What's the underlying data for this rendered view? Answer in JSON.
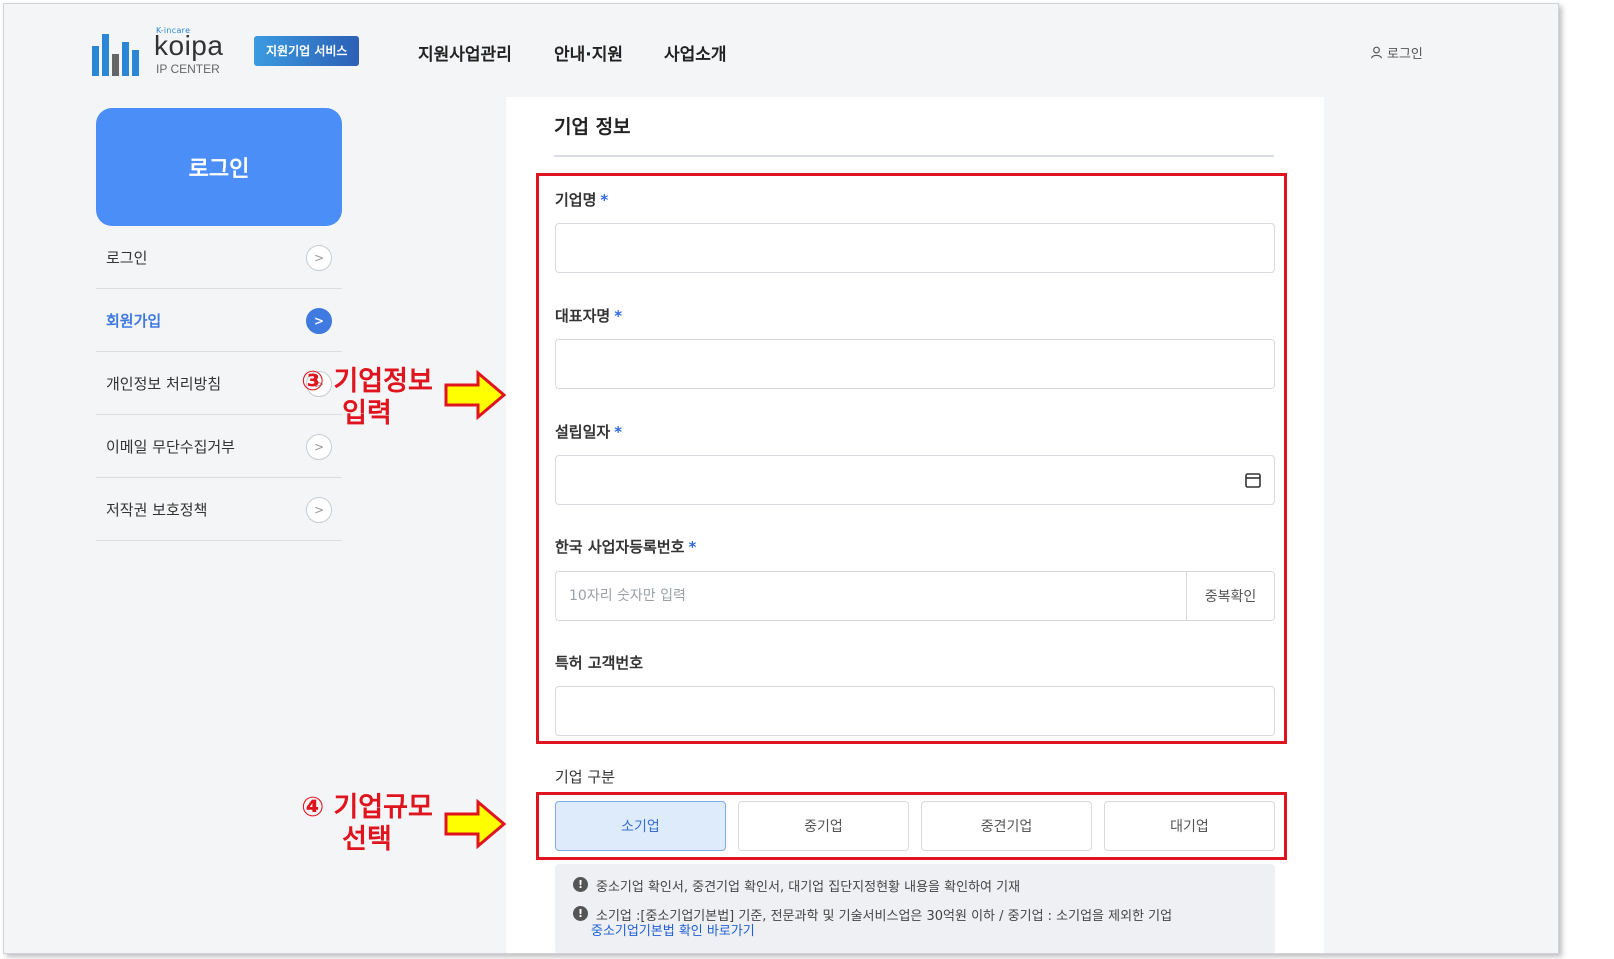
{
  "header": {
    "logo_small": "K-incare",
    "logo_word": "koipa",
    "logo_sub": "IP CENTER",
    "service_badge": "지원기업 서비스",
    "nav": [
      "지원사업관리",
      "안내·지원",
      "사업소개"
    ],
    "login": "로그인"
  },
  "sidebar": {
    "title": "로그인",
    "items": [
      {
        "label": "로그인",
        "active": false
      },
      {
        "label": "회원가입",
        "active": true
      },
      {
        "label": "개인정보 처리방침",
        "active": false
      },
      {
        "label": "이메일 무단수집거부",
        "active": false
      },
      {
        "label": "저작권 보호정책",
        "active": false
      }
    ]
  },
  "form": {
    "section_title": "기업 정보",
    "fields": {
      "company_name": {
        "label": "기업명",
        "required": "*",
        "value": ""
      },
      "ceo_name": {
        "label": "대표자명",
        "required": "*",
        "value": ""
      },
      "founded_date": {
        "label": "설립일자",
        "required": "*",
        "value": ""
      },
      "biz_reg_no": {
        "label": "한국 사업자등록번호",
        "required": "*",
        "placeholder": "10자리 숫자만 입력",
        "button": "중복확인"
      },
      "patent_customer_no": {
        "label": "특허 고객번호",
        "value": ""
      }
    },
    "company_size": {
      "label": "기업 구분",
      "options": [
        "소기업",
        "중기업",
        "중견기업",
        "대기업"
      ],
      "selected": "소기업"
    },
    "notes": [
      "중소기업 확인서, 중견기업 확인서, 대기업 집단지정현황 내용을 확인하여 기재",
      "소기업 :[중소기업기본법] 기준, 전문과학 및 기술서비스업은 30억원 이하 / 중기업 : 소기업을 제외한 기업"
    ],
    "note_link": "중소기업기본법 확인 바로가기"
  },
  "annotations": {
    "step3_line1": "③ 기업정보",
    "step3_line2": "입력",
    "step4_line1": "④ 기업규모",
    "step4_line2": "선택",
    "color": "#e0141e"
  },
  "colors": {
    "accent": "#4b8ef7",
    "active_link": "#3f7ae0",
    "selected_bg": "#deebfb"
  }
}
